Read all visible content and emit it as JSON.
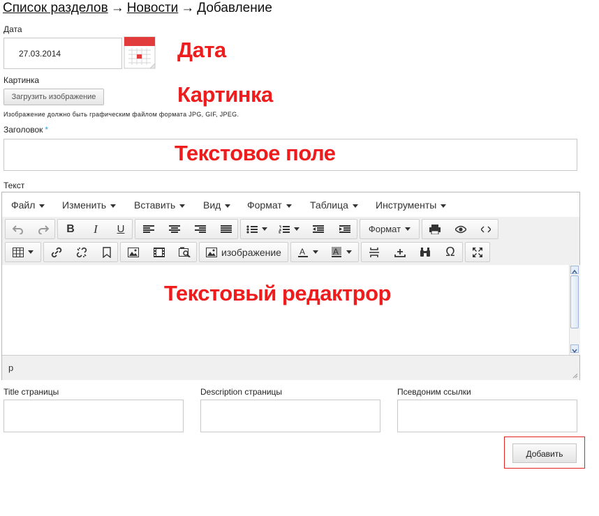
{
  "breadcrumb": {
    "item1": "Список разделов",
    "separator": "→",
    "item2": "Новости",
    "current": "Добавление"
  },
  "date": {
    "label": "Дата",
    "value": "27.03.2014",
    "annotation": "Дата"
  },
  "image": {
    "label": "Картинка",
    "button": "Загрузить изображение",
    "hint": "Изображение должно быть графическим файлом формата JPG, GIF, JPEG.",
    "annotation": "Картинка"
  },
  "heading": {
    "label": "Заголовок",
    "required_mark": "*",
    "annotation": "Текстовое поле"
  },
  "text": {
    "label": "Текст",
    "annotation": "Текстовый редактрор"
  },
  "editor": {
    "menus": [
      "Файл",
      "Изменить",
      "Вставить",
      "Вид",
      "Формат",
      "Таблица",
      "Инструменты"
    ],
    "format_dropdown": "Формат",
    "image_button": "изображение",
    "status_path": "p"
  },
  "seo": {
    "title_label": "Title страницы",
    "description_label": "Description страницы",
    "alias_label": "Псевдоним ссылки"
  },
  "submit": {
    "label": "Добавить"
  },
  "colors": {
    "annotation": "#ee1c1c",
    "required": "#2aa3d8",
    "highlight_frame": "#e32020"
  }
}
